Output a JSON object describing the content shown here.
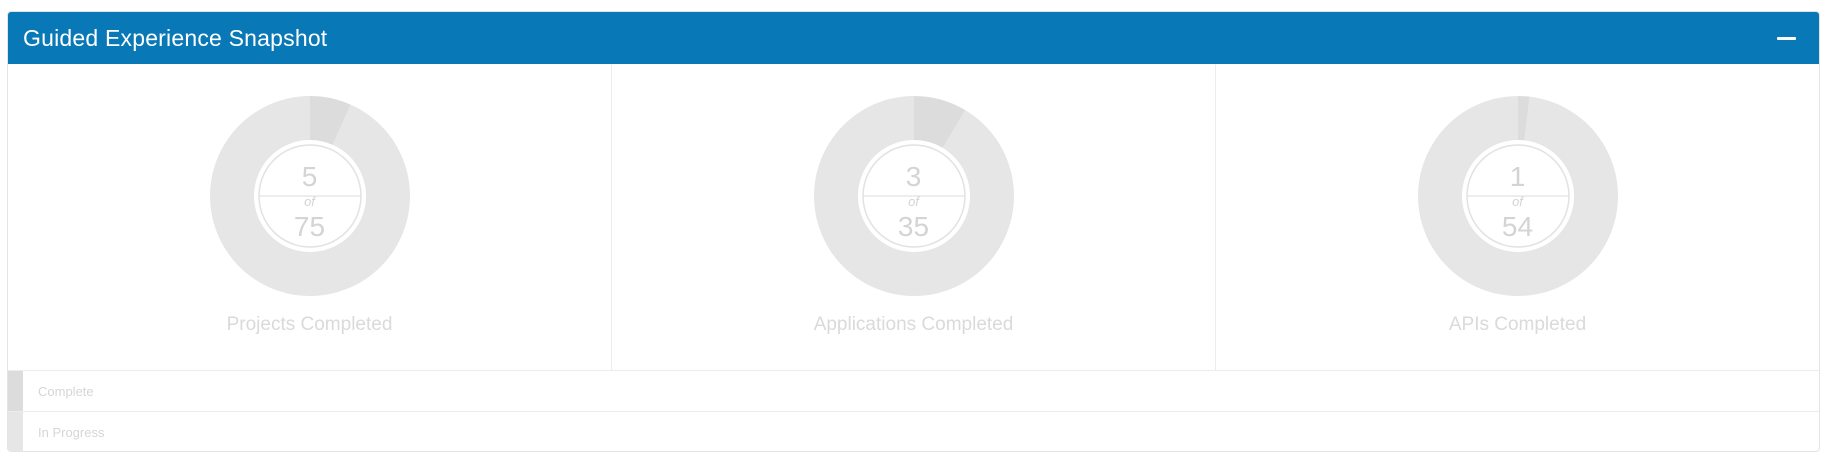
{
  "panel": {
    "title": "Guided Experience Snapshot",
    "collapse_icon": "minus-icon"
  },
  "colors": {
    "header": "#0878b6",
    "complete": "#dcdcdc",
    "in_progress": "#e6e6e6"
  },
  "chart_data": [
    {
      "type": "pie",
      "title": "Projects Completed",
      "center": {
        "count": "5",
        "of": "of",
        "total": "75"
      },
      "slices": [
        {
          "name": "Complete",
          "value": 5
        },
        {
          "name": "In Progress",
          "value": 70
        }
      ]
    },
    {
      "type": "pie",
      "title": "Applications Completed",
      "center": {
        "count": "3",
        "of": "of",
        "total": "35"
      },
      "slices": [
        {
          "name": "Complete",
          "value": 3
        },
        {
          "name": "In Progress",
          "value": 32
        }
      ]
    },
    {
      "type": "pie",
      "title": "APIs Completed",
      "center": {
        "count": "1",
        "of": "of",
        "total": "54"
      },
      "slices": [
        {
          "name": "Complete",
          "value": 1
        },
        {
          "name": "In Progress",
          "value": 53
        }
      ]
    }
  ],
  "legend": [
    {
      "label": "Complete"
    },
    {
      "label": "In Progress"
    }
  ]
}
